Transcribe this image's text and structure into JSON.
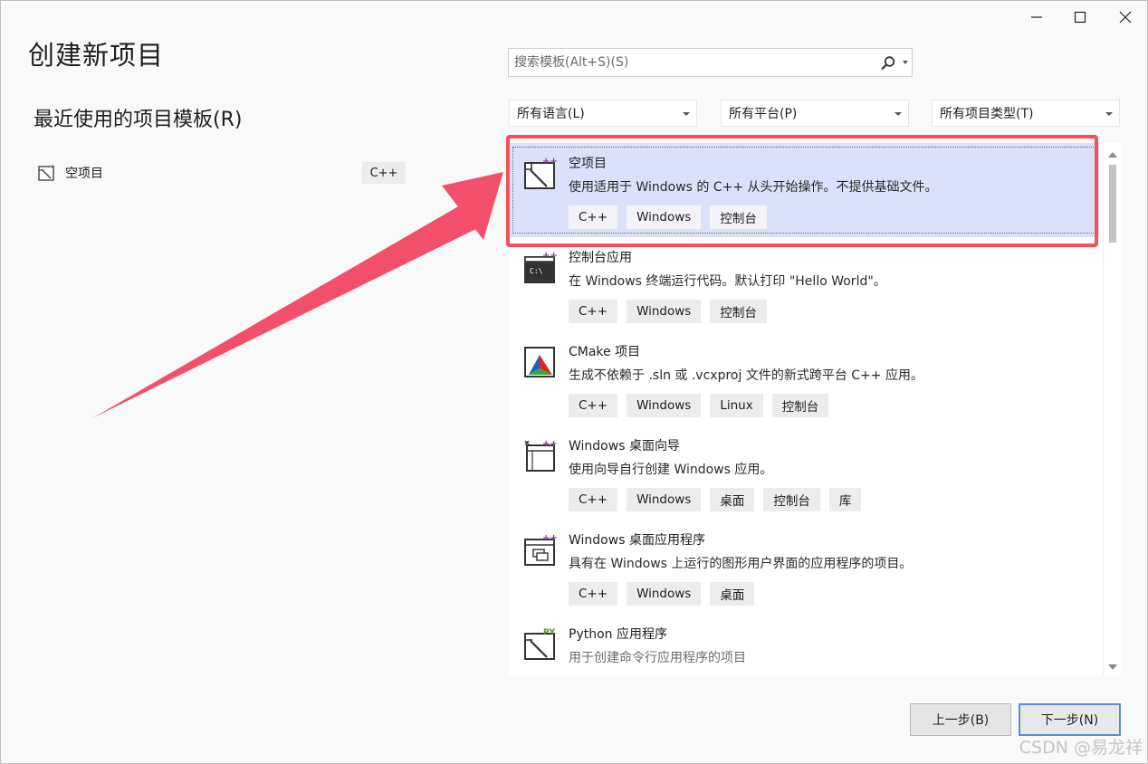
{
  "window": {
    "title": "创建新项目",
    "controls": [
      "minimize",
      "maximize",
      "close"
    ]
  },
  "recent": {
    "heading": "最近使用的项目模板(R)",
    "items": [
      {
        "label": "空项目",
        "lang": "C++",
        "icon": "empty-project-icon"
      }
    ]
  },
  "search": {
    "placeholder": "搜索模板(Alt+S)(S)"
  },
  "filters": {
    "language": "所有语言(L)",
    "platform": "所有平台(P)",
    "project_type": "所有项目类型(T)"
  },
  "templates": [
    {
      "name": "空项目",
      "desc": "使用适用于 Windows 的 C++ 从头开始操作。不提供基础文件。",
      "tags": [
        "C++",
        "Windows",
        "控制台"
      ],
      "icon": "empty-project-icon",
      "selected": true
    },
    {
      "name": "控制台应用",
      "desc": "在 Windows 终端运行代码。默认打印 \"Hello World\"。",
      "tags": [
        "C++",
        "Windows",
        "控制台"
      ],
      "icon": "console-app-icon"
    },
    {
      "name": "CMake 项目",
      "desc": "生成不依赖于 .sln 或 .vcxproj 文件的新式跨平台 C++ 应用。",
      "tags": [
        "C++",
        "Windows",
        "Linux",
        "控制台"
      ],
      "icon": "cmake-icon"
    },
    {
      "name": "Windows 桌面向导",
      "desc": "使用向导自行创建 Windows 应用。",
      "tags": [
        "C++",
        "Windows",
        "桌面",
        "控制台",
        "库"
      ],
      "icon": "desktop-wizard-icon"
    },
    {
      "name": "Windows 桌面应用程序",
      "desc": "具有在 Windows 上运行的图形用户界面的应用程序的项目。",
      "tags": [
        "C++",
        "Windows",
        "桌面"
      ],
      "icon": "desktop-app-icon"
    },
    {
      "name": "Python 应用程序",
      "desc": "用于创建命令行应用程序的项目",
      "tags": [],
      "icon": "python-app-icon"
    }
  ],
  "buttons": {
    "prev": "上一步(B)",
    "next": "下一步(N)"
  },
  "annotation": {
    "highlight_color": "#f0505f",
    "arrow_color": "#f2506a"
  },
  "watermark": "CSDN @易龙祥"
}
